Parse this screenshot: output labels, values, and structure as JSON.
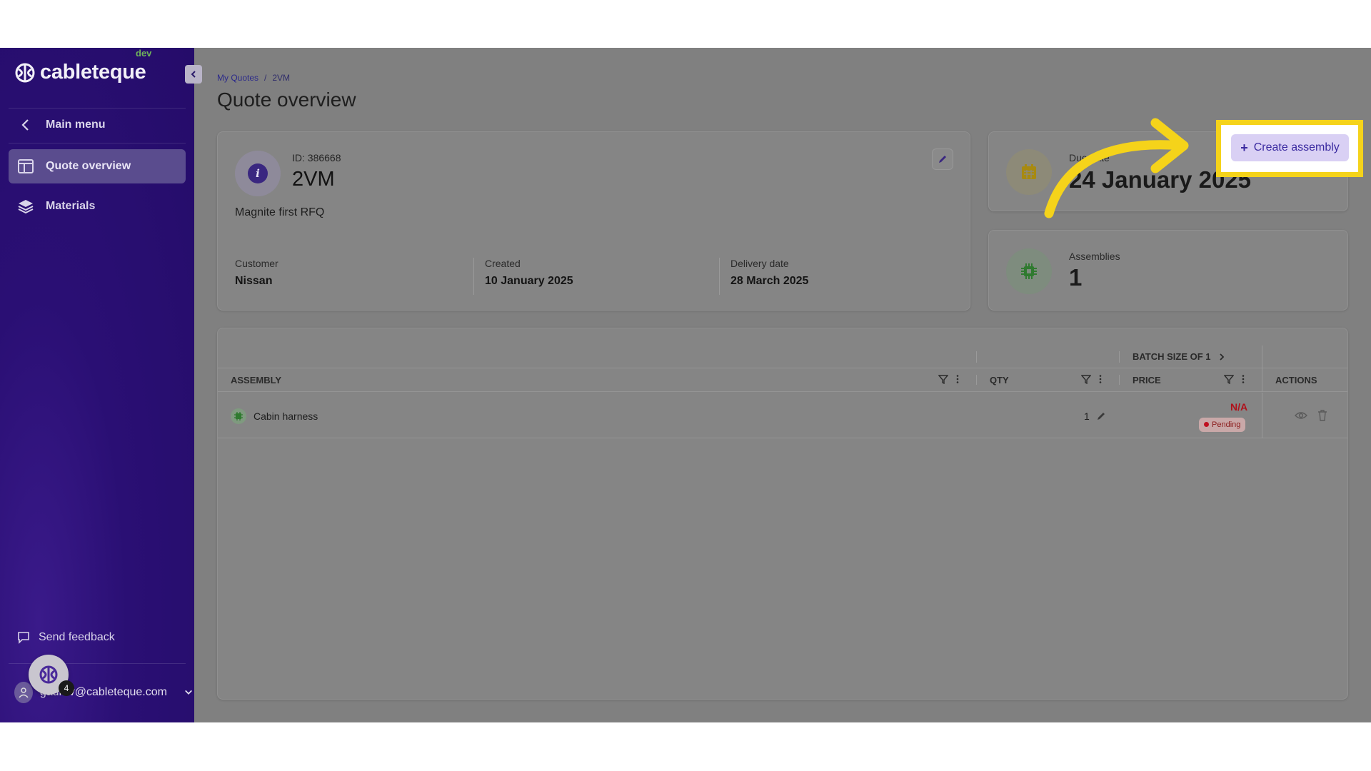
{
  "app": {
    "logo_text": "cableteque",
    "env_tag": "dev"
  },
  "sidebar": {
    "main_menu": "Main menu",
    "items": [
      {
        "label": "Quote overview",
        "icon": "layout-icon",
        "active": true
      },
      {
        "label": "Materials",
        "icon": "layers-icon",
        "active": false
      }
    ],
    "feedback": "Send feedback",
    "user_email": "gaurav@cableteque.com",
    "notification_count": "4"
  },
  "breadcrumb": {
    "root": "My Quotes",
    "separator": "/",
    "current": "2VM"
  },
  "page_title": "Quote overview",
  "quote": {
    "id_label": "ID: 386668",
    "name": "2VM",
    "description": "Magnite first RFQ",
    "customer_label": "Customer",
    "customer": "Nissan",
    "created_label": "Created",
    "created": "10 January 2025",
    "delivery_label": "Delivery date",
    "delivery": "28 March 2025"
  },
  "due": {
    "label": "Due date",
    "value": "24 January 2025"
  },
  "assemblies": {
    "label": "Assemblies",
    "value": "1"
  },
  "table": {
    "batch_label": "BATCH SIZE OF 1",
    "headers": {
      "assembly": "ASSEMBLY",
      "qty": "QTY",
      "price": "PRICE",
      "actions": "ACTIONS"
    },
    "rows": [
      {
        "name": "Cabin harness",
        "qty": "1",
        "price": "N/A",
        "status": "Pending"
      }
    ]
  },
  "actions": {
    "create_assembly": "Create assembly"
  },
  "colors": {
    "sidebar": "#250c6a",
    "highlight": "#f5d31a",
    "accent": "#3a2aa0",
    "price_na": "#b0101a"
  }
}
